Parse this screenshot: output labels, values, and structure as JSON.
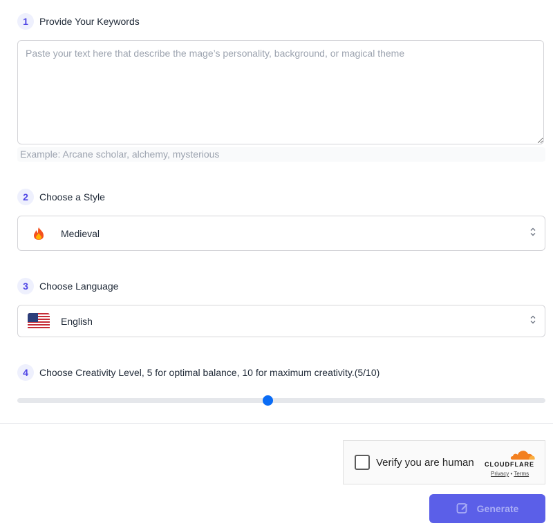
{
  "steps": [
    {
      "number": "1",
      "label": "Provide Your Keywords"
    },
    {
      "number": "2",
      "label": "Choose a Style"
    },
    {
      "number": "3",
      "label": "Choose Language"
    },
    {
      "number": "4",
      "label": "Choose Creativity Level, 5 for optimal balance, 10 for maximum creativity.(5/10)"
    }
  ],
  "keywords": {
    "value": "",
    "placeholder": "Paste your text here that describe the mage’s personality, background, or magical theme",
    "example": "Example:  Arcane scholar, alchemy, mysterious"
  },
  "style_select": {
    "icon": "fire-icon",
    "value": "Medieval"
  },
  "language_select": {
    "icon": "us-flag-icon",
    "value": "English"
  },
  "creativity": {
    "value": 5,
    "max": 10,
    "min": 0
  },
  "captcha": {
    "label": "Verify you are human",
    "brand": "CLOUDFLARE",
    "privacy": "Privacy",
    "separator": "•",
    "terms": "Terms"
  },
  "generate": {
    "label": "Generate",
    "icon": "edit-icon"
  },
  "colors": {
    "accent": "#5b5fe8",
    "slider": "#0a6cf5",
    "cloudflare": "#f38020"
  }
}
